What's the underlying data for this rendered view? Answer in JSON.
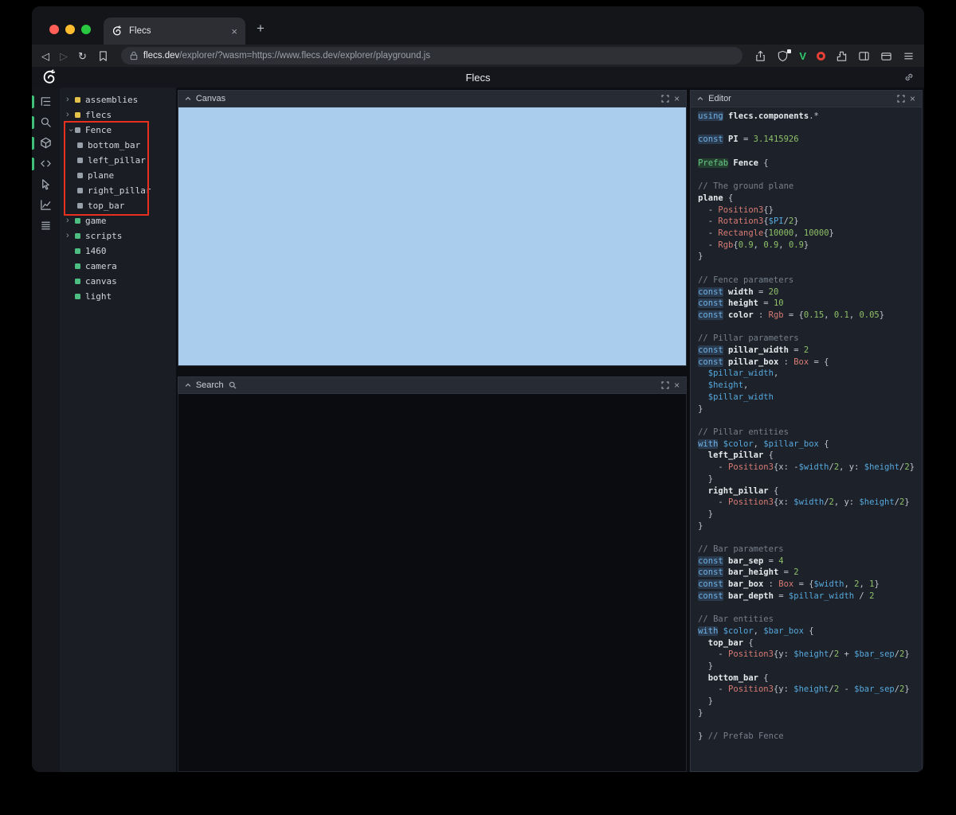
{
  "browser": {
    "tab_title": "Flecs",
    "new_tab_label": "+",
    "back_glyph": "◁",
    "forward_glyph": "▷",
    "reload_glyph": "↻",
    "url_domain": "flecs.dev",
    "url_path": "/explorer/?wasm=https://www.flecs.dev/explorer/playground.js",
    "extension_v_label": "V"
  },
  "app": {
    "title": "Flecs"
  },
  "panels": {
    "canvas_title": "Canvas",
    "search_title": "Search",
    "editor_title": "Editor",
    "close_glyph": "×"
  },
  "icons": {
    "chrome": [
      "back-icon",
      "forward-icon",
      "reload-icon",
      "bookmark-icon",
      "lock-icon",
      "share-icon",
      "shield-icon",
      "vimium-extension-icon",
      "red-circle-extension-icon",
      "puzzle-extension-icon",
      "sidebar-toggle-icon",
      "wallet-icon",
      "menu-icon"
    ],
    "app": [
      "flecs-logo-icon",
      "link-icon",
      "chevron-up-icon",
      "expand-icon",
      "close-icon",
      "magnifier-icon"
    ]
  },
  "rail": {
    "icons": [
      {
        "name": "entity-tree-icon",
        "active": true
      },
      {
        "name": "search-icon",
        "active": true
      },
      {
        "name": "entities-icon",
        "active": true
      },
      {
        "name": "code-icon",
        "active": true
      },
      {
        "name": "inspector-icon",
        "active": false
      },
      {
        "name": "stats-icon",
        "active": false
      },
      {
        "name": "tables-icon",
        "active": false
      }
    ]
  },
  "tree": {
    "items": [
      {
        "label": "assemblies",
        "state": "collapsed",
        "color": "yellow",
        "depth": 0
      },
      {
        "label": "flecs",
        "state": "collapsed",
        "color": "yellow",
        "depth": 0
      },
      {
        "label": "Fence",
        "state": "expanded",
        "color": "gray",
        "depth": 0
      },
      {
        "label": "bottom_bar",
        "state": "none",
        "color": "gray",
        "depth": 1
      },
      {
        "label": "left_pillar",
        "state": "none",
        "color": "gray",
        "depth": 1
      },
      {
        "label": "plane",
        "state": "none",
        "color": "gray",
        "depth": 1
      },
      {
        "label": "right_pillar",
        "state": "none",
        "color": "gray",
        "depth": 1
      },
      {
        "label": "top_bar",
        "state": "none",
        "color": "gray",
        "depth": 1
      },
      {
        "label": "game",
        "state": "collapsed",
        "color": "green",
        "depth": 0
      },
      {
        "label": "scripts",
        "state": "collapsed",
        "color": "green",
        "depth": 0
      },
      {
        "label": "1460",
        "state": "none",
        "color": "green",
        "depth": 0
      },
      {
        "label": "camera",
        "state": "none",
        "color": "green",
        "depth": 0
      },
      {
        "label": "canvas",
        "state": "none",
        "color": "green",
        "depth": 0
      },
      {
        "label": "light",
        "state": "none",
        "color": "green",
        "depth": 0
      }
    ]
  },
  "code": {
    "lines": [
      [
        [
          "k",
          "using"
        ],
        [
          "t",
          " "
        ],
        [
          "i",
          "flecs.components"
        ],
        [
          "t",
          ".*"
        ]
      ],
      [],
      [
        [
          "k",
          "const"
        ],
        [
          "t",
          " "
        ],
        [
          "i",
          "PI"
        ],
        [
          "t",
          " = "
        ],
        [
          "n",
          "3.1415926"
        ]
      ],
      [],
      [
        [
          "p",
          "Prefab"
        ],
        [
          "t",
          " "
        ],
        [
          "i",
          "Fence"
        ],
        [
          "t",
          " {"
        ]
      ],
      [],
      [
        [
          "m",
          "// The ground plane"
        ]
      ],
      [
        [
          "i",
          "plane"
        ],
        [
          "t",
          " {"
        ]
      ],
      [
        [
          "t",
          "  - "
        ],
        [
          "c",
          "Position3"
        ],
        [
          "t",
          "{}"
        ]
      ],
      [
        [
          "t",
          "  - "
        ],
        [
          "c",
          "Rotation3"
        ],
        [
          "t",
          "{"
        ],
        [
          "v",
          "$PI"
        ],
        [
          "t",
          "/"
        ],
        [
          "n",
          "2"
        ],
        [
          "t",
          "}"
        ]
      ],
      [
        [
          "t",
          "  - "
        ],
        [
          "c",
          "Rectangle"
        ],
        [
          "t",
          "{"
        ],
        [
          "n",
          "10000"
        ],
        [
          "t",
          ", "
        ],
        [
          "n",
          "10000"
        ],
        [
          "t",
          "}"
        ]
      ],
      [
        [
          "t",
          "  - "
        ],
        [
          "c",
          "Rgb"
        ],
        [
          "t",
          "{"
        ],
        [
          "n",
          "0.9"
        ],
        [
          "t",
          ", "
        ],
        [
          "n",
          "0.9"
        ],
        [
          "t",
          ", "
        ],
        [
          "n",
          "0.9"
        ],
        [
          "t",
          "}"
        ]
      ],
      [
        [
          "t",
          "}"
        ]
      ],
      [],
      [
        [
          "m",
          "// Fence parameters"
        ]
      ],
      [
        [
          "k",
          "const"
        ],
        [
          "t",
          " "
        ],
        [
          "i",
          "width"
        ],
        [
          "t",
          " = "
        ],
        [
          "n",
          "20"
        ]
      ],
      [
        [
          "k",
          "const"
        ],
        [
          "t",
          " "
        ],
        [
          "i",
          "height"
        ],
        [
          "t",
          " = "
        ],
        [
          "n",
          "10"
        ]
      ],
      [
        [
          "k",
          "const"
        ],
        [
          "t",
          " "
        ],
        [
          "i",
          "color"
        ],
        [
          "t",
          " : "
        ],
        [
          "c",
          "Rgb"
        ],
        [
          "t",
          " = {"
        ],
        [
          "n",
          "0.15"
        ],
        [
          "t",
          ", "
        ],
        [
          "n",
          "0.1"
        ],
        [
          "t",
          ", "
        ],
        [
          "n",
          "0.05"
        ],
        [
          "t",
          "}"
        ]
      ],
      [],
      [
        [
          "m",
          "// Pillar parameters"
        ]
      ],
      [
        [
          "k",
          "const"
        ],
        [
          "t",
          " "
        ],
        [
          "i",
          "pillar_width"
        ],
        [
          "t",
          " = "
        ],
        [
          "n",
          "2"
        ]
      ],
      [
        [
          "k",
          "const"
        ],
        [
          "t",
          " "
        ],
        [
          "i",
          "pillar_box"
        ],
        [
          "t",
          " : "
        ],
        [
          "c",
          "Box"
        ],
        [
          "t",
          " = {"
        ]
      ],
      [
        [
          "t",
          "  "
        ],
        [
          "v",
          "$pillar_width"
        ],
        [
          "t",
          ","
        ]
      ],
      [
        [
          "t",
          "  "
        ],
        [
          "v",
          "$height"
        ],
        [
          "t",
          ","
        ]
      ],
      [
        [
          "t",
          "  "
        ],
        [
          "v",
          "$pillar_width"
        ]
      ],
      [
        [
          "t",
          "}"
        ]
      ],
      [],
      [
        [
          "m",
          "// Pillar entities"
        ]
      ],
      [
        [
          "k",
          "with"
        ],
        [
          "t",
          " "
        ],
        [
          "v",
          "$color"
        ],
        [
          "t",
          ", "
        ],
        [
          "v",
          "$pillar_box"
        ],
        [
          "t",
          " {"
        ]
      ],
      [
        [
          "t",
          "  "
        ],
        [
          "i",
          "left_pillar"
        ],
        [
          "t",
          " {"
        ]
      ],
      [
        [
          "t",
          "    - "
        ],
        [
          "c",
          "Position3"
        ],
        [
          "t",
          "{x: -"
        ],
        [
          "v",
          "$width"
        ],
        [
          "t",
          "/"
        ],
        [
          "n",
          "2"
        ],
        [
          "t",
          ", y: "
        ],
        [
          "v",
          "$height"
        ],
        [
          "t",
          "/"
        ],
        [
          "n",
          "2"
        ],
        [
          "t",
          "}"
        ]
      ],
      [
        [
          "t",
          "  }"
        ]
      ],
      [
        [
          "t",
          "  "
        ],
        [
          "i",
          "right_pillar"
        ],
        [
          "t",
          " {"
        ]
      ],
      [
        [
          "t",
          "    - "
        ],
        [
          "c",
          "Position3"
        ],
        [
          "t",
          "{x: "
        ],
        [
          "v",
          "$width"
        ],
        [
          "t",
          "/"
        ],
        [
          "n",
          "2"
        ],
        [
          "t",
          ", y: "
        ],
        [
          "v",
          "$height"
        ],
        [
          "t",
          "/"
        ],
        [
          "n",
          "2"
        ],
        [
          "t",
          "}"
        ]
      ],
      [
        [
          "t",
          "  }"
        ]
      ],
      [
        [
          "t",
          "}"
        ]
      ],
      [],
      [
        [
          "m",
          "// Bar parameters"
        ]
      ],
      [
        [
          "k",
          "const"
        ],
        [
          "t",
          " "
        ],
        [
          "i",
          "bar_sep"
        ],
        [
          "t",
          " = "
        ],
        [
          "n",
          "4"
        ]
      ],
      [
        [
          "k",
          "const"
        ],
        [
          "t",
          " "
        ],
        [
          "i",
          "bar_height"
        ],
        [
          "t",
          " = "
        ],
        [
          "n",
          "2"
        ]
      ],
      [
        [
          "k",
          "const"
        ],
        [
          "t",
          " "
        ],
        [
          "i",
          "bar_box"
        ],
        [
          "t",
          " : "
        ],
        [
          "c",
          "Box"
        ],
        [
          "t",
          " = {"
        ],
        [
          "v",
          "$width"
        ],
        [
          "t",
          ", "
        ],
        [
          "n",
          "2"
        ],
        [
          "t",
          ", "
        ],
        [
          "n",
          "1"
        ],
        [
          "t",
          "}"
        ]
      ],
      [
        [
          "k",
          "const"
        ],
        [
          "t",
          " "
        ],
        [
          "i",
          "bar_depth"
        ],
        [
          "t",
          " = "
        ],
        [
          "v",
          "$pillar_width"
        ],
        [
          "t",
          " / "
        ],
        [
          "n",
          "2"
        ]
      ],
      [],
      [
        [
          "m",
          "// Bar entities"
        ]
      ],
      [
        [
          "k",
          "with"
        ],
        [
          "t",
          " "
        ],
        [
          "v",
          "$color"
        ],
        [
          "t",
          ", "
        ],
        [
          "v",
          "$bar_box"
        ],
        [
          "t",
          " {"
        ]
      ],
      [
        [
          "t",
          "  "
        ],
        [
          "i",
          "top_bar"
        ],
        [
          "t",
          " {"
        ]
      ],
      [
        [
          "t",
          "    - "
        ],
        [
          "c",
          "Position3"
        ],
        [
          "t",
          "{y: "
        ],
        [
          "v",
          "$height"
        ],
        [
          "t",
          "/"
        ],
        [
          "n",
          "2"
        ],
        [
          "t",
          " + "
        ],
        [
          "v",
          "$bar_sep"
        ],
        [
          "t",
          "/"
        ],
        [
          "n",
          "2"
        ],
        [
          "t",
          "}"
        ]
      ],
      [
        [
          "t",
          "  }"
        ]
      ],
      [
        [
          "t",
          "  "
        ],
        [
          "i",
          "bottom_bar"
        ],
        [
          "t",
          " {"
        ]
      ],
      [
        [
          "t",
          "    - "
        ],
        [
          "c",
          "Position3"
        ],
        [
          "t",
          "{y: "
        ],
        [
          "v",
          "$height"
        ],
        [
          "t",
          "/"
        ],
        [
          "n",
          "2"
        ],
        [
          "t",
          " - "
        ],
        [
          "v",
          "$bar_sep"
        ],
        [
          "t",
          "/"
        ],
        [
          "n",
          "2"
        ],
        [
          "t",
          "}"
        ]
      ],
      [
        [
          "t",
          "  }"
        ]
      ],
      [
        [
          "t",
          "}"
        ]
      ],
      [],
      [
        [
          "t",
          "} "
        ],
        [
          "m",
          "// Prefab Fence"
        ]
      ]
    ]
  },
  "colors": {
    "canvas_blue": "#aacdee",
    "annotation_red": "#e8301f",
    "indicator_green": "#3fbf77"
  }
}
